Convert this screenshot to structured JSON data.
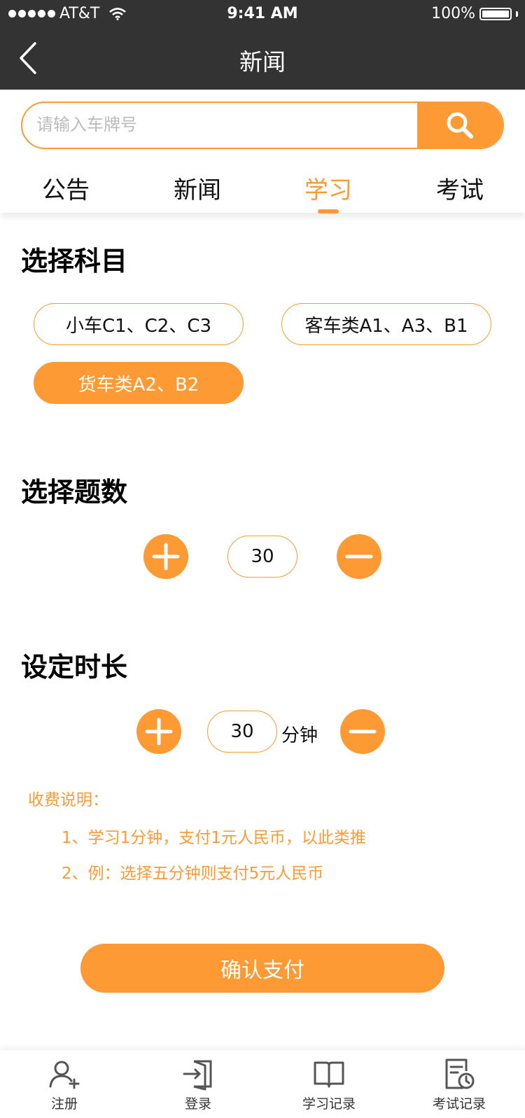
{
  "status_bar": {
    "carrier": "AT&T",
    "time": "9:41 AM",
    "battery": "100%"
  },
  "nav": {
    "title": "新闻"
  },
  "search": {
    "placeholder": "请输入车牌号"
  },
  "tabs": [
    {
      "label": "公告",
      "active": false
    },
    {
      "label": "新闻",
      "active": false
    },
    {
      "label": "学习",
      "active": true
    },
    {
      "label": "考试",
      "active": false
    }
  ],
  "subject": {
    "title": "选择科目",
    "options": [
      {
        "label": "小车C1、C2、C3",
        "selected": false
      },
      {
        "label": "客车类A1、A3、B1",
        "selected": false
      },
      {
        "label": "货车类A2、B2",
        "selected": true
      }
    ]
  },
  "question_count": {
    "title": "选择题数",
    "value": "30"
  },
  "duration": {
    "title": "设定时长",
    "value": "30",
    "unit": "分钟"
  },
  "fee_notes": {
    "title": "收费说明：",
    "items": [
      "1、学习1分钟，支付1元人民币，以此类推",
      "2、例：选择五分钟则支付5元人民币"
    ]
  },
  "confirm_button": "确认支付",
  "bottom_nav": [
    {
      "label": "注册",
      "icon": "user-add-icon"
    },
    {
      "label": "登录",
      "icon": "login-icon"
    },
    {
      "label": "学习记录",
      "icon": "book-icon"
    },
    {
      "label": "考试记录",
      "icon": "exam-record-icon"
    }
  ],
  "colors": {
    "accent": "#FD9A34",
    "header": "#333333"
  }
}
